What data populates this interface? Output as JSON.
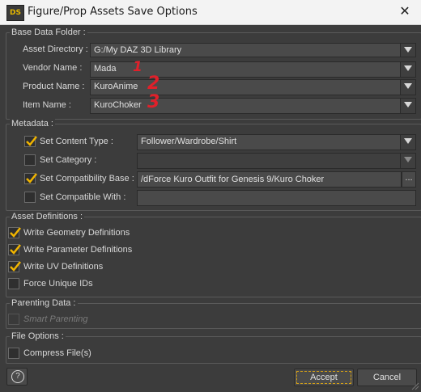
{
  "window": {
    "app_icon_text": "DS",
    "title": "Figure/Prop Assets Save Options",
    "close_glyph": "✕"
  },
  "base_data_folder": {
    "title": "Base Data Folder :",
    "asset_directory_label": "Asset Directory :",
    "asset_directory_value": "G:/My DAZ 3D Library",
    "vendor_name_label": "Vendor Name :",
    "vendor_name_value": "Mada",
    "product_name_label": "Product Name :",
    "product_name_value": "KuroAnime",
    "item_name_label": "Item Name :",
    "item_name_value": "KuroChoker"
  },
  "annotations": [
    "1",
    "2",
    "3"
  ],
  "metadata": {
    "title": "Metadata :",
    "content_type": {
      "label": "Set Content Type :",
      "checked": true,
      "value": "Follower/Wardrobe/Shirt"
    },
    "category": {
      "label": "Set Category :",
      "checked": false,
      "value": ""
    },
    "compatibility_base": {
      "label": "Set Compatibility Base :",
      "checked": true,
      "value": "/dForce Kuro Outfit for Genesis 9/Kuro Choker",
      "browse": "..."
    },
    "compatible_with": {
      "label": "Set Compatible With :",
      "checked": false,
      "value": ""
    }
  },
  "asset_definitions": {
    "title": "Asset Definitions :",
    "items": [
      {
        "label": "Write Geometry Definitions",
        "checked": true
      },
      {
        "label": "Write Parameter Definitions",
        "checked": true
      },
      {
        "label": "Write UV Definitions",
        "checked": true
      },
      {
        "label": "Force Unique IDs",
        "checked": false
      }
    ]
  },
  "parenting_data": {
    "title": "Parenting Data :",
    "smart_parenting_label": "Smart Parenting",
    "checked": false,
    "disabled": true
  },
  "file_options": {
    "title": "File Options :",
    "compress_label": "Compress File(s)",
    "checked": false
  },
  "footer": {
    "help_glyph": "?",
    "accept_label": "Accept",
    "cancel_label": "Cancel"
  },
  "colors": {
    "background": "#3c3c3c",
    "check": "#f0b400",
    "annotation": "#e0202a"
  }
}
